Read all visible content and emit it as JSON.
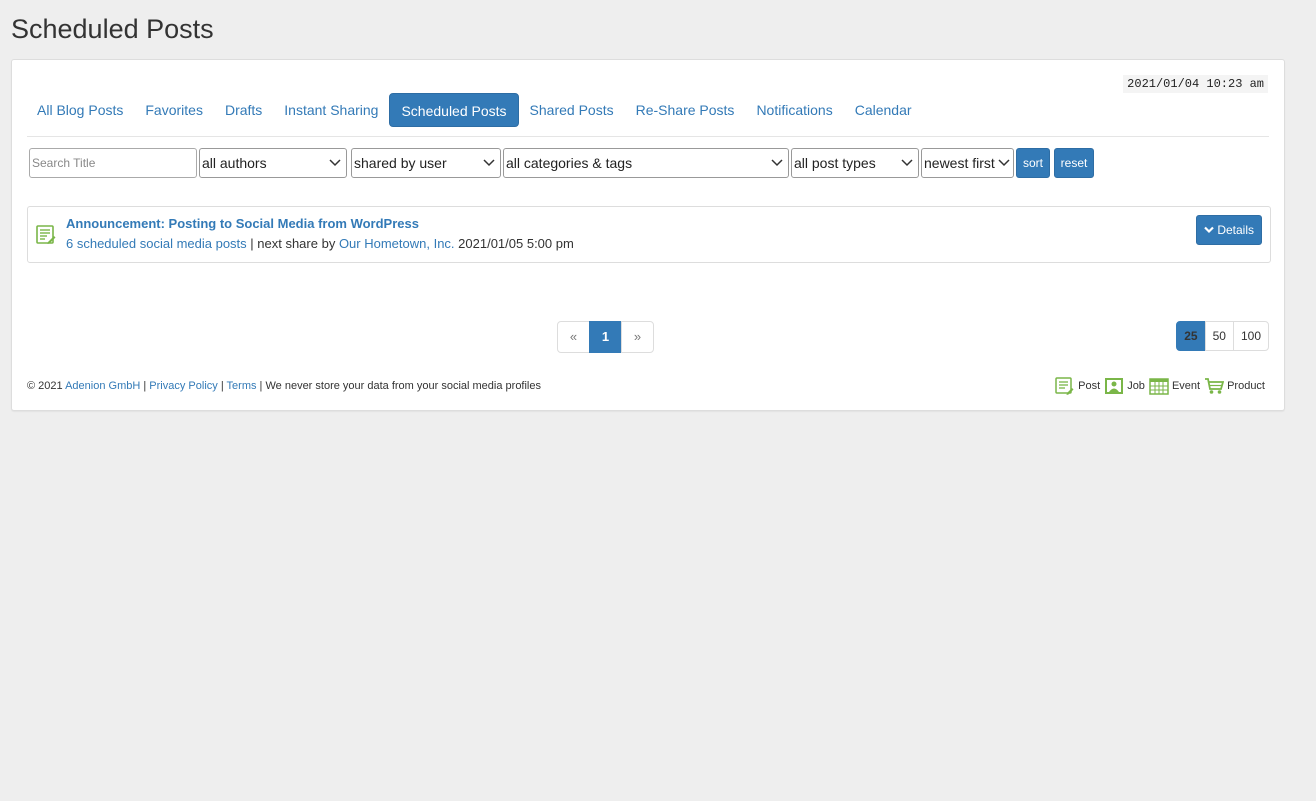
{
  "page": {
    "title": "Scheduled Posts"
  },
  "clock": "2021/01/04 10:23 am",
  "tabs": [
    {
      "label": "All Blog Posts",
      "active": false
    },
    {
      "label": "Favorites",
      "active": false
    },
    {
      "label": "Drafts",
      "active": false
    },
    {
      "label": "Instant Sharing",
      "active": false
    },
    {
      "label": "Scheduled Posts",
      "active": true
    },
    {
      "label": "Shared Posts",
      "active": false
    },
    {
      "label": "Re-Share Posts",
      "active": false
    },
    {
      "label": "Notifications",
      "active": false
    },
    {
      "label": "Calendar",
      "active": false
    }
  ],
  "filters": {
    "search_placeholder": "Search Title",
    "authors": "all authors",
    "shared_by": "shared by user",
    "categories": "all categories & tags",
    "post_types": "all post types",
    "order": "newest first",
    "sort_label": "sort",
    "reset_label": "reset"
  },
  "post": {
    "title": "Announcement: Posting to Social Media from WordPress",
    "scheduled_link": "6 scheduled social media posts",
    "separator": " | next share by ",
    "account": "Our Hometown, Inc.",
    "next_share": " 2021/01/05 5:00 pm",
    "details_label": "Details"
  },
  "pagination": {
    "prev": "«",
    "current": "1",
    "next": "»"
  },
  "per_page": {
    "options": [
      "25",
      "50",
      "100"
    ],
    "selected": "25"
  },
  "footer": {
    "copyright": "© 2021 ",
    "company": "Adenion GmbH",
    "sep1": " | ",
    "privacy": "Privacy Policy",
    "sep2": " | ",
    "terms": "Terms",
    "note": " | We never store your data from your social media profiles"
  },
  "legend": {
    "post": "Post",
    "job": "Job",
    "event": "Event",
    "product": "Product"
  },
  "colors": {
    "accent": "#337ab7",
    "icon_green": "#7ab648"
  }
}
